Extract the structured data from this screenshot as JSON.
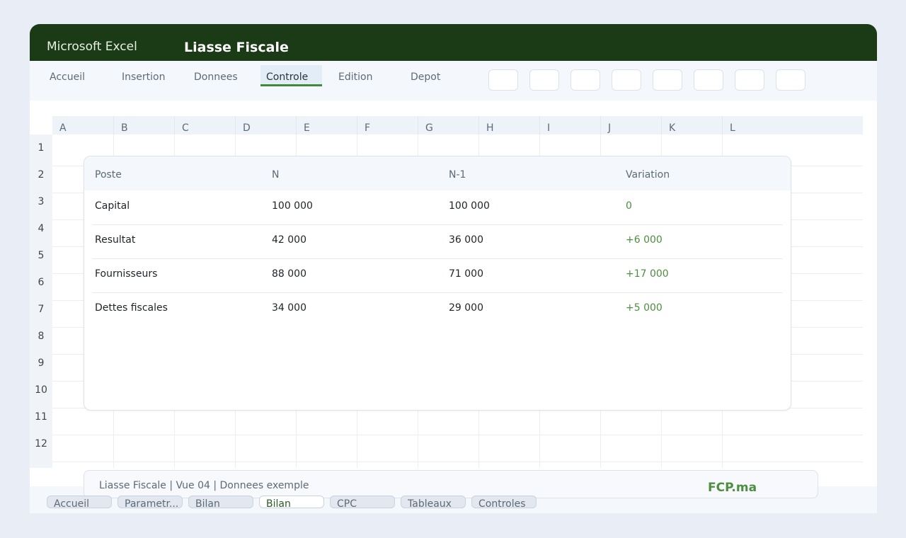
{
  "window": {
    "app_name": "Microsoft Excel",
    "doc_title": "Liasse Fiscale"
  },
  "ribbon": {
    "tabs": [
      {
        "label": "Accueil",
        "active": false
      },
      {
        "label": "Insertion",
        "active": false
      },
      {
        "label": "Donnees",
        "active": false
      },
      {
        "label": "Controle",
        "active": true
      },
      {
        "label": "Edition",
        "active": false
      },
      {
        "label": "Depot",
        "active": false
      }
    ],
    "tool_button_count": 8
  },
  "sheet": {
    "columns": [
      "A",
      "B",
      "C",
      "D",
      "E",
      "F",
      "G",
      "H",
      "I",
      "J",
      "K",
      "L"
    ],
    "rows": [
      "1",
      "2",
      "3",
      "4",
      "5",
      "6",
      "7",
      "8",
      "9",
      "10",
      "11",
      "12"
    ]
  },
  "panel": {
    "headers": [
      "Poste",
      "N",
      "N-1",
      "Variation"
    ],
    "rows": [
      {
        "poste": "Capital",
        "n": "100 000",
        "n1": "100 000",
        "variation": "0"
      },
      {
        "poste": "Resultat",
        "n": "42 000",
        "n1": "36 000",
        "variation": "+6 000"
      },
      {
        "poste": "Fournisseurs",
        "n": "88 000",
        "n1": "71 000",
        "variation": "+17 000"
      },
      {
        "poste": "Dettes fiscales",
        "n": "34 000",
        "n1": "29 000",
        "variation": "+5 000"
      }
    ]
  },
  "status": {
    "text": "Liasse Fiscale | Vue 04 | Donnees exemple",
    "brand": "FCP.ma"
  },
  "sheet_tabs": [
    {
      "label": "Accueil",
      "active": false
    },
    {
      "label": "Parametr...",
      "active": false
    },
    {
      "label": "Bilan",
      "active": false
    },
    {
      "label": "Bilan",
      "active": true
    },
    {
      "label": "CPC",
      "active": false
    },
    {
      "label": "Tableaux",
      "active": false
    },
    {
      "label": "Controles",
      "active": false
    }
  ],
  "colors": {
    "titlebar": "#1b3b16",
    "accent_green": "#4c8f3f",
    "background": "#e9edf5"
  }
}
